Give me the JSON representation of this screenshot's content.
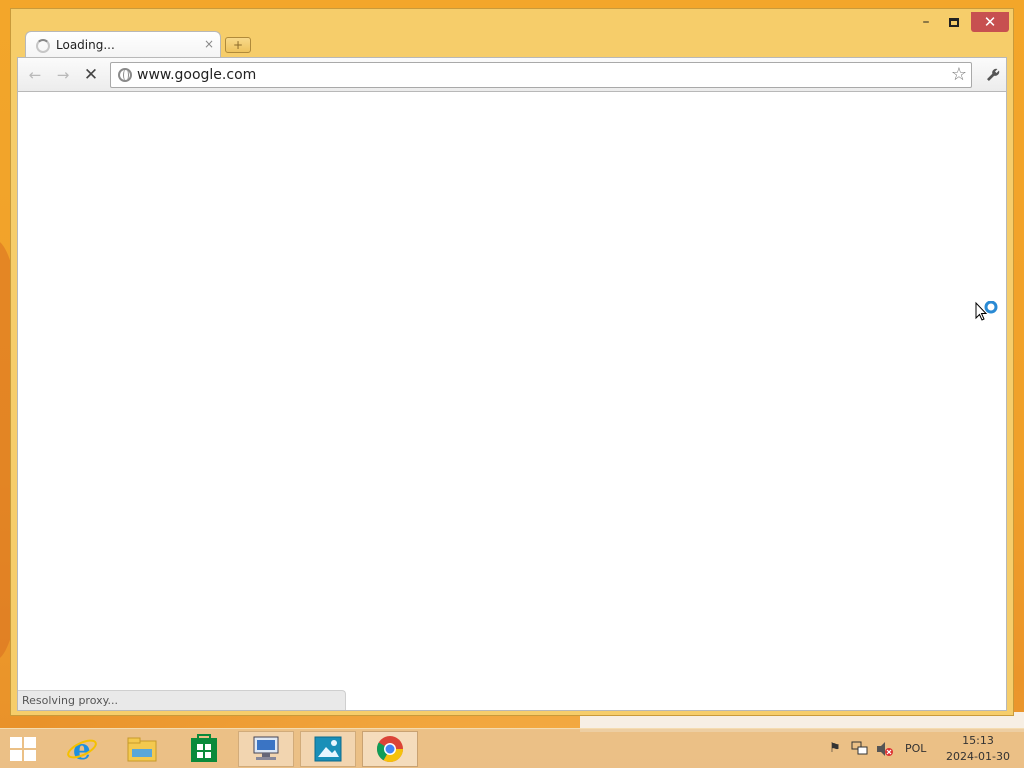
{
  "browser": {
    "tab": {
      "title": "Loading...",
      "close_label": "×"
    },
    "new_tab_label": "+",
    "window_controls": {
      "minimize": "–",
      "close": "✕"
    },
    "nav": {
      "back": "←",
      "forward": "→",
      "stop": "✕"
    },
    "omnibox": {
      "url": "www.google.com"
    },
    "status_text": "Resolving proxy..."
  },
  "taskbar": {
    "items": [
      {
        "name": "Internet Explorer",
        "icon": "ie-icon"
      },
      {
        "name": "File Explorer",
        "icon": "folder-icon"
      },
      {
        "name": "Store",
        "icon": "store-icon"
      },
      {
        "name": "Remote Desktop",
        "icon": "remote-desktop-icon"
      },
      {
        "name": "Photos",
        "icon": "photos-icon"
      },
      {
        "name": "Google Chrome",
        "icon": "chrome-icon"
      }
    ],
    "tray": {
      "language": "POL",
      "time": "15:13",
      "date": "2024-01-30"
    }
  },
  "colors": {
    "desktop": "#f3a62a",
    "window_frame": "#f6cd6a",
    "close_button": "#c75050"
  }
}
